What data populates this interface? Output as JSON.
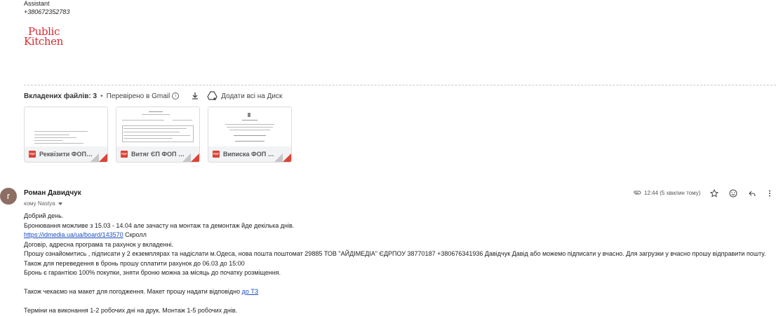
{
  "signature": {
    "role": "Assistant",
    "phone": "+380672352783",
    "logo_line1": "Public",
    "logo_line2": "Kitchen"
  },
  "attachments_bar": {
    "count_label": "Вкладених файлів: 3",
    "verified_label": "Перевірено в Gmail",
    "add_to_drive_label": "Додати всі на Диск"
  },
  "attachments": [
    {
      "name": "Реквізити ФОП Г...",
      "type": "PDF"
    },
    {
      "name": "Витяг ЄП ФОП Гу...",
      "type": "PDF"
    },
    {
      "name": "Виписка ФОП Гу...",
      "type": "PDF"
    }
  ],
  "message": {
    "avatar_letter": "r",
    "avatar_color": "#8d6e63",
    "sender": "Роман Давидчук",
    "recipient": "кому Nastya",
    "time": "12:44 (5 хвилин тому)",
    "body": {
      "line1": "Добрий день.",
      "line2": "Бронювання можливе з  15.03 - 14.04 але зачасту на монтаж та демонтаж йде декілька днів.",
      "link1": "https://idmedia.ua/ua/board/143570",
      "line3_suffix": " Скролл",
      "line4": "Договір, адресна програма та рахунок у вкладенні.",
      "line5": "Прошу ознайомитись , підписати у 2 екземплярах та надіслати м.Одеса, нова пошта поштомат 29885 ТОВ \"АЙДІМЕДІА\" ЄДРПОУ 38770187 +380676341936  Давідчук Давід  або можемо підписати у вчасно. Для загрузки у вчасно прошу відправити пошту.",
      "line6": "Також для переведення в бронь прошу сплатити рахунок до 06.03 до 15:00",
      "line7": "Бронь є гарантією 100% покупки, зняти броню можна за місяць до початку розміщення.",
      "line8_prefix": "Також чекаємо на макет для погодження.  Макет прошу надати відповідно ",
      "line8_link": "до ТЗ",
      "line9": "Терміни на виконання 1-2 робочих дні на друк. Монтаж 1-5 робочих днів."
    }
  },
  "colors": {
    "brand_red": "#d62b33",
    "pdf_red": "#db4437",
    "link": "#1a4dbf"
  },
  "icons": [
    "info-icon",
    "download-icon",
    "add-to-drive-icon",
    "pdf-icon",
    "attachment-clip-icon",
    "star-icon",
    "emoji-icon",
    "reply-icon",
    "more-vert-icon",
    "dropdown-icon"
  ]
}
